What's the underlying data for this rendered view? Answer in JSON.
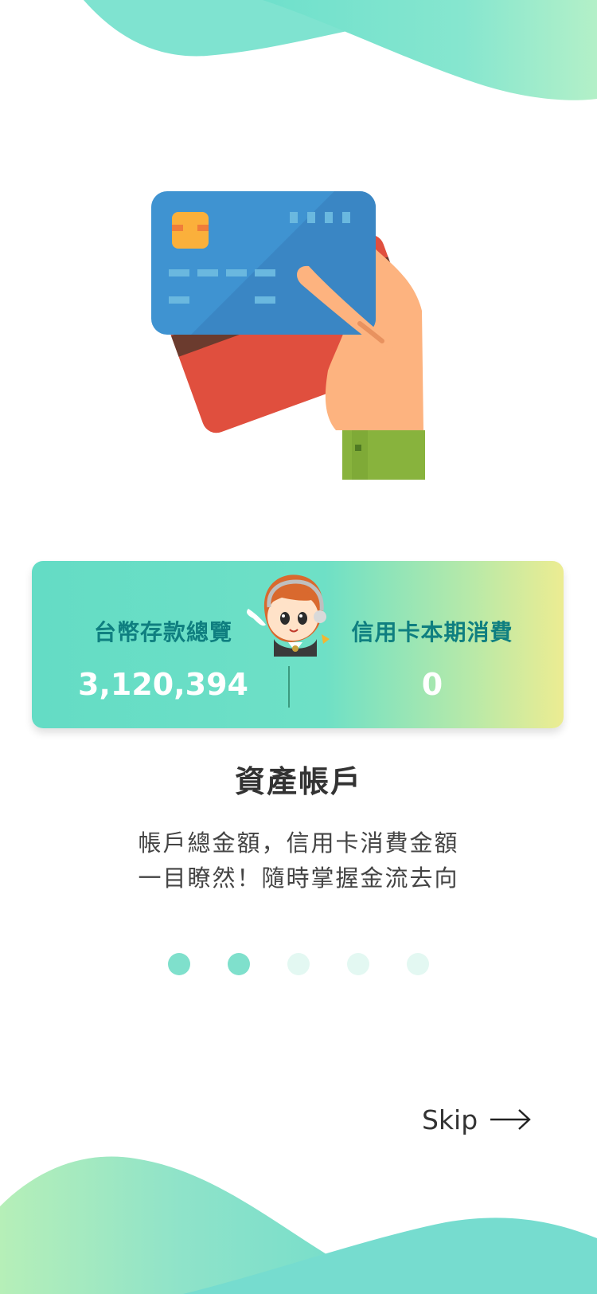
{
  "colors": {
    "accent": "#6ddfc6",
    "accent_dark": "#0f7f80",
    "dot_active": "#7fe0cc",
    "dot_inactive": "#e3f8f2"
  },
  "hero": {
    "icon": "hand-holding-credit-cards-icon"
  },
  "summary_card": {
    "mascot_icon": "customer-service-mascot-icon",
    "deposits": {
      "label": "台幣存款總覽",
      "value": "3,120,394"
    },
    "credit_card": {
      "label": "信用卡本期消費",
      "value": "0"
    }
  },
  "title": "資產帳戶",
  "description": {
    "line1": "帳戶總金額，信用卡消費金額",
    "line2": "一目瞭然！隨時掌握金流去向"
  },
  "pagination": {
    "total": 5,
    "active": [
      1,
      2
    ]
  },
  "skip": {
    "label": "Skip",
    "icon": "arrow-right-icon"
  }
}
